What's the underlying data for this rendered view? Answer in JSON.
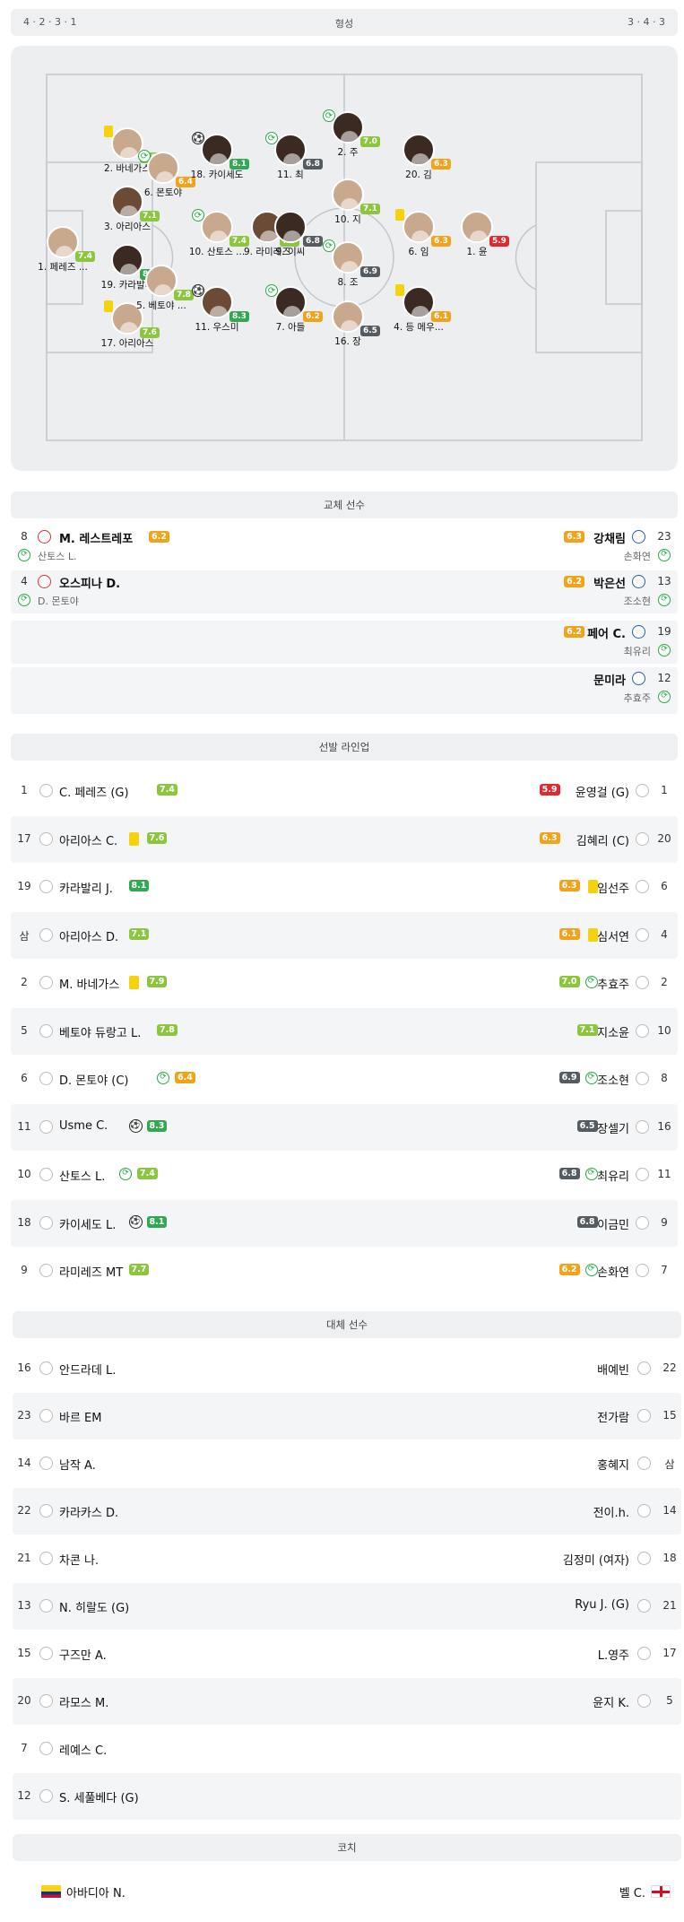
{
  "formation": {
    "left": "4 · 2 · 3 · 1",
    "center": "형성",
    "right": "3 · 4 · 3"
  },
  "pitch_players": [
    {
      "name": "1. 페레즈 ...",
      "rating": "7.4",
      "rc": "lime",
      "ev": "",
      "av": "l"
    },
    {
      "name": "2. 바네가스",
      "rating": "7.9",
      "rc": "lime",
      "ev": "yc",
      "av": "l"
    },
    {
      "name": "3. 아리아스",
      "rating": "7.1",
      "rc": "lime",
      "ev": "",
      "av": "d"
    },
    {
      "name": "19. 카라발리",
      "rating": "8.1",
      "rc": "green",
      "ev": "",
      "av": "h"
    },
    {
      "name": "17. 아리아스",
      "rating": "7.6",
      "rc": "lime",
      "ev": "yc",
      "av": "l"
    },
    {
      "name": "6. 몬토야",
      "rating": "6.4",
      "rc": "orange",
      "ev": "sub",
      "av": "l"
    },
    {
      "name": "5. 베토야 ...",
      "rating": "7.8",
      "rc": "lime",
      "ev": "",
      "av": "l"
    },
    {
      "name": "18. 카이세도",
      "rating": "8.1",
      "rc": "green",
      "ev": "ball",
      "av": "h"
    },
    {
      "name": "10. 산토스 ...",
      "rating": "7.4",
      "rc": "lime",
      "ev": "sub",
      "av": "l"
    },
    {
      "name": "11. 우스미",
      "rating": "8.3",
      "rc": "green",
      "ev": "ball",
      "av": "d"
    },
    {
      "name": "9. 라미레즈",
      "rating": "7.7",
      "rc": "lime",
      "ev": "",
      "av": "d"
    },
    {
      "name": "11. 최",
      "rating": "6.8",
      "rc": "grey",
      "ev": "sub",
      "av": "h"
    },
    {
      "name": "9. 이씨",
      "rating": "6.8",
      "rc": "grey",
      "ev": "",
      "av": "h"
    },
    {
      "name": "7. 아들",
      "rating": "6.2",
      "rc": "orange",
      "ev": "sub",
      "av": "h"
    },
    {
      "name": "2. 주",
      "rating": "7.0",
      "rc": "lime",
      "ev": "sub",
      "av": "h"
    },
    {
      "name": "10. 지",
      "rating": "7.1",
      "rc": "lime",
      "ev": "",
      "av": "l"
    },
    {
      "name": "8. 조",
      "rating": "6.9",
      "rc": "grey",
      "ev": "sub",
      "av": "l"
    },
    {
      "name": "16. 장",
      "rating": "6.5",
      "rc": "grey",
      "ev": "",
      "av": "l"
    },
    {
      "name": "20. 김",
      "rating": "6.3",
      "rc": "orange",
      "ev": "",
      "av": "h"
    },
    {
      "name": "6. 임",
      "rating": "6.3",
      "rc": "orange",
      "ev": "yc",
      "av": "l"
    },
    {
      "name": "4. 등 메우...",
      "rating": "6.1",
      "rc": "orange",
      "ev": "yc",
      "av": "h"
    },
    {
      "name": "1. 윤",
      "rating": "5.9",
      "rc": "red",
      "ev": "",
      "av": "l"
    }
  ],
  "substitutes_header": "교체 선수",
  "substitutes": [
    {
      "left": {
        "num": "8",
        "name": "M. 레스트레포",
        "rating": "6.2",
        "sub": "산토스 L."
      },
      "right": {
        "num": "23",
        "name": "강채림",
        "rating": "6.3",
        "sub": "손화연"
      }
    },
    {
      "left": {
        "num": "4",
        "name": "오스피나 D.",
        "rating": "",
        "sub": "D. 몬토야"
      },
      "right": {
        "num": "13",
        "name": "박은선",
        "rating": "6.2",
        "sub": "조소현"
      }
    },
    {
      "left": null,
      "right": {
        "num": "19",
        "name": "페어 C.",
        "rating": "6.2",
        "sub": "최유리"
      }
    },
    {
      "left": null,
      "right": {
        "num": "12",
        "name": "문미라",
        "rating": "",
        "sub": "추효주"
      }
    }
  ],
  "lineup_header": "선발 라인업",
  "lineup": [
    {
      "l": {
        "num": "1",
        "name": "C. 페레즈 (G)",
        "rating": "7.4",
        "rc": "lime",
        "ev": ""
      },
      "r": {
        "num": "1",
        "name": "윤영걸 (G)",
        "rating": "5.9",
        "rc": "red",
        "ev": ""
      }
    },
    {
      "l": {
        "num": "17",
        "name": "아리아스 C.",
        "rating": "7.6",
        "rc": "lime",
        "ev": "yc"
      },
      "r": {
        "num": "20",
        "name": "김혜리 (C)",
        "rating": "6.3",
        "rc": "orange",
        "ev": ""
      }
    },
    {
      "l": {
        "num": "19",
        "name": "카라발리 J.",
        "rating": "8.1",
        "rc": "green",
        "ev": ""
      },
      "r": {
        "num": "6",
        "name": "임선주",
        "rating": "6.3",
        "rc": "orange",
        "ev": "yc"
      }
    },
    {
      "l": {
        "num": "삼",
        "name": "아리아스 D.",
        "rating": "7.1",
        "rc": "lime",
        "ev": ""
      },
      "r": {
        "num": "4",
        "name": "심서연",
        "rating": "6.1",
        "rc": "orange",
        "ev": "yc"
      }
    },
    {
      "l": {
        "num": "2",
        "name": "M. 바네가스",
        "rating": "7.9",
        "rc": "lime",
        "ev": "yc"
      },
      "r": {
        "num": "2",
        "name": "추효주",
        "rating": "7.0",
        "rc": "lime",
        "ev": "sub"
      }
    },
    {
      "l": {
        "num": "5",
        "name": "베토야 듀랑고 L.",
        "rating": "7.8",
        "rc": "lime",
        "ev": ""
      },
      "r": {
        "num": "10",
        "name": "지소윤",
        "rating": "7.1",
        "rc": "lime",
        "ev": ""
      }
    },
    {
      "l": {
        "num": "6",
        "name": "D. 몬토야 (C)",
        "rating": "6.4",
        "rc": "orange",
        "ev": "sub"
      },
      "r": {
        "num": "8",
        "name": "조소현",
        "rating": "6.9",
        "rc": "grey",
        "ev": "sub"
      }
    },
    {
      "l": {
        "num": "11",
        "name": "Usme C.",
        "rating": "8.3",
        "rc": "green",
        "ev": "ball"
      },
      "r": {
        "num": "16",
        "name": "장셀기",
        "rating": "6.5",
        "rc": "grey",
        "ev": ""
      }
    },
    {
      "l": {
        "num": "10",
        "name": "산토스 L.",
        "rating": "7.4",
        "rc": "lime",
        "ev": "sub"
      },
      "r": {
        "num": "11",
        "name": "최유리",
        "rating": "6.8",
        "rc": "grey",
        "ev": "sub"
      }
    },
    {
      "l": {
        "num": "18",
        "name": "카이세도 L.",
        "rating": "8.1",
        "rc": "green",
        "ev": "ball"
      },
      "r": {
        "num": "9",
        "name": "이금민",
        "rating": "6.8",
        "rc": "grey",
        "ev": ""
      }
    },
    {
      "l": {
        "num": "9",
        "name": "라미레즈 MT",
        "rating": "7.7",
        "rc": "lime",
        "ev": ""
      },
      "r": {
        "num": "7",
        "name": "손화연",
        "rating": "6.2",
        "rc": "orange",
        "ev": "sub"
      }
    }
  ],
  "bench_header": "대체 선수",
  "bench": [
    {
      "l": {
        "num": "16",
        "name": "안드라데 L."
      },
      "r": {
        "num": "22",
        "name": "배예빈"
      }
    },
    {
      "l": {
        "num": "23",
        "name": "바르 EM"
      },
      "r": {
        "num": "15",
        "name": "전가람"
      }
    },
    {
      "l": {
        "num": "14",
        "name": "남작 A."
      },
      "r": {
        "num": "삼",
        "name": "홍혜지"
      }
    },
    {
      "l": {
        "num": "22",
        "name": "카라카스 D."
      },
      "r": {
        "num": "14",
        "name": "전이.h."
      }
    },
    {
      "l": {
        "num": "21",
        "name": "차콘 나."
      },
      "r": {
        "num": "18",
        "name": "김정미 (여자)"
      }
    },
    {
      "l": {
        "num": "13",
        "name": "N. 히랄도 (G)"
      },
      "r": {
        "num": "21",
        "name": "Ryu J. (G)"
      }
    },
    {
      "l": {
        "num": "15",
        "name": "구즈만 A."
      },
      "r": {
        "num": "17",
        "name": "L.영주"
      }
    },
    {
      "l": {
        "num": "20",
        "name": "라모스 M."
      },
      "r": {
        "num": "5",
        "name": "윤지 K."
      }
    },
    {
      "l": {
        "num": "7",
        "name": "레예스 C."
      },
      "r": null
    },
    {
      "l": {
        "num": "12",
        "name": "S. 세풀베다 (G)"
      },
      "r": null
    }
  ],
  "coach_header": "코치",
  "coach": {
    "left": "아바디아 N.",
    "right": "벨 C."
  },
  "colors": {
    "lime": "#8cc63f",
    "green": "#32a852",
    "orange": "#f2a21b",
    "grey": "#555c61",
    "red": "#e0282e",
    "yellow_card": "#f5d20b"
  }
}
